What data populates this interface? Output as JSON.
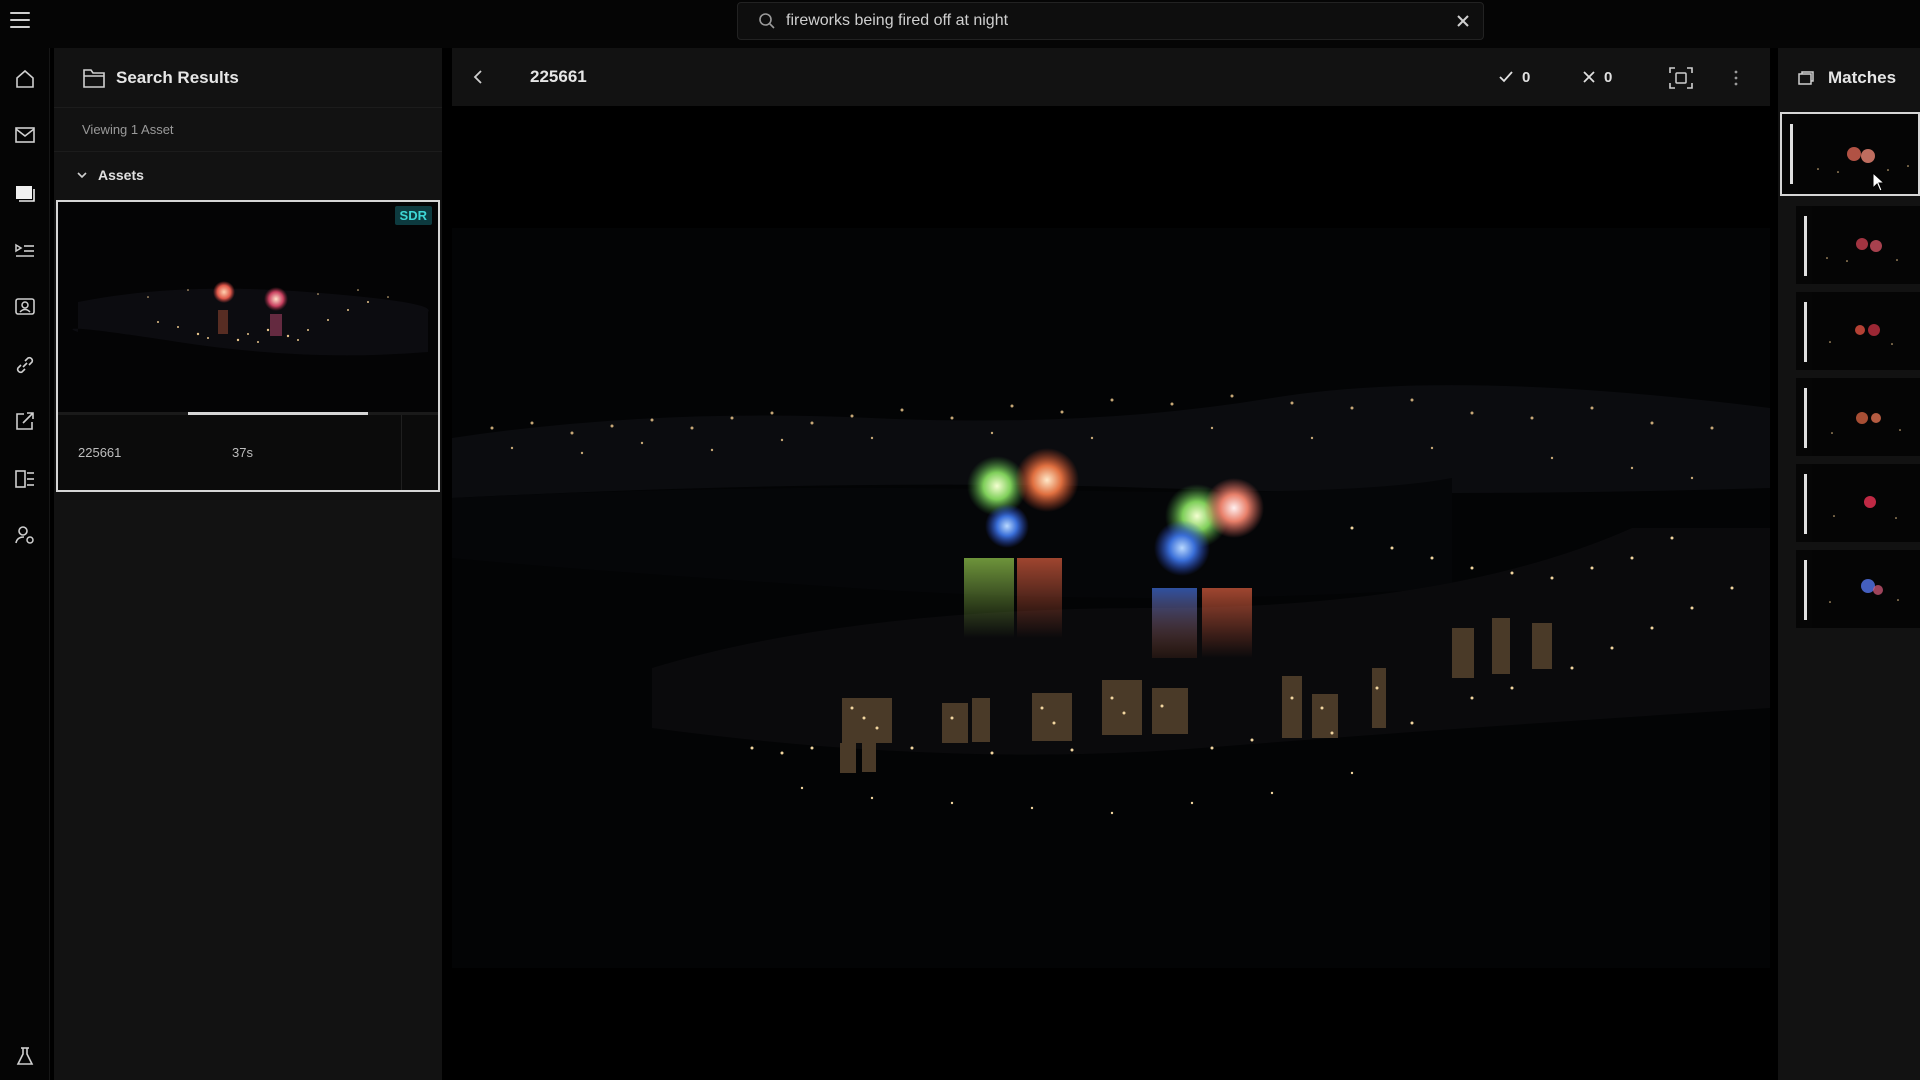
{
  "search": {
    "query": "fireworks being fired off at night"
  },
  "nav": {
    "items": [
      "home",
      "inbox",
      "assets",
      "playlists",
      "portraits",
      "links",
      "share",
      "collections",
      "people",
      "lab"
    ]
  },
  "results": {
    "title": "Search Results",
    "viewing": "Viewing 1 Asset",
    "section": "Assets",
    "asset": {
      "badge": "SDR",
      "id": "225661",
      "duration": "37s"
    }
  },
  "viewer": {
    "title": "225661",
    "approve_count": "0",
    "reject_count": "0"
  },
  "matches": {
    "title": "Matches",
    "count_shown": 6
  },
  "colors": {
    "badge_bg": "#0d3a3f",
    "badge_text": "#3ed6d6",
    "panel_bg": "#121212"
  }
}
